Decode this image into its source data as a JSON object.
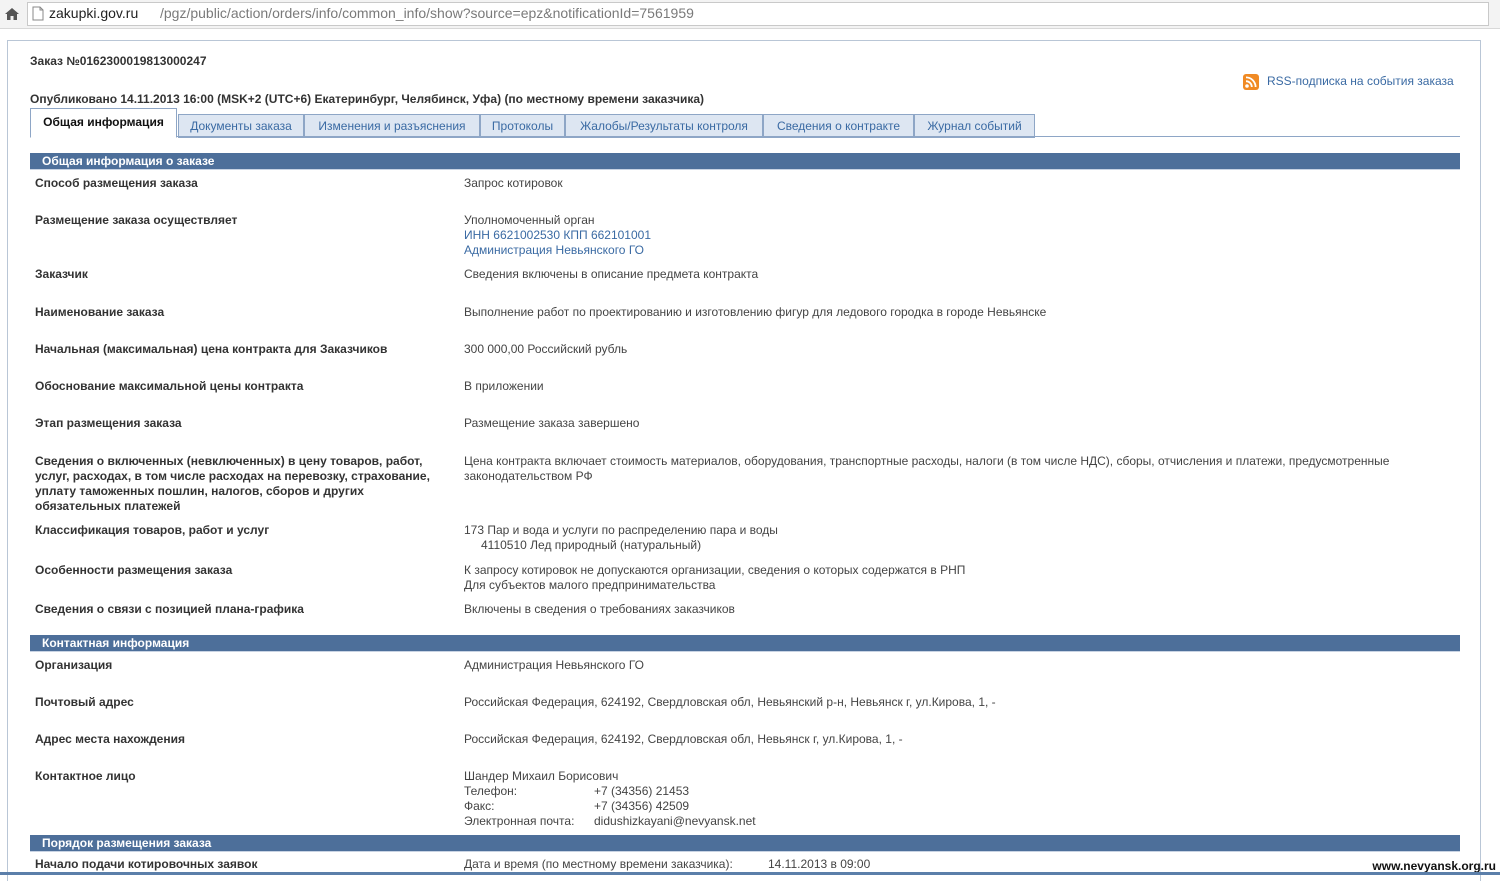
{
  "browser": {
    "url_host": "zakupki.gov.ru",
    "url_path": "/pgz/public/action/orders/info/common_info/show?source=epz&notificationId=7561959"
  },
  "page": {
    "order_number": "Заказ №0162300019813000247",
    "published": "Опубликовано 14.11.2013 16:00 (MSK+2 (UTC+6) Екатеринбург, Челябинск, Уфа) (по местному времени заказчика)",
    "rss_label": "RSS-подписка на события заказа"
  },
  "tabs": [
    "Общая информация",
    "Документы заказа",
    "Изменения и разъяснения",
    "Протоколы",
    "Жалобы/Результаты контроля",
    "Сведения о контракте",
    "Журнал событий"
  ],
  "general": {
    "title": "Общая информация о заказе",
    "method_label": "Способ размещения заказа",
    "method_value": "Запрос котировок",
    "placer_label": "Размещение заказа осуществляет",
    "placer_type": "Уполномоченный орган",
    "placer_inn": "ИНН 6621002530 КПП 662101001",
    "placer_org": "Администрация Невьянского ГО",
    "customer_label": "Заказчик",
    "customer_value": "Сведения включены в описание предмета контракта",
    "name_label": "Наименование заказа",
    "name_value": "Выполнение работ по проектированию и изготовлению фигур для ледового городка в городе Невьянске",
    "price_label": "Начальная (максимальная) цена контракта для Заказчиков",
    "price_value": "300 000,00 Российский рубль",
    "justification_label": "Обоснование максимальной цены контракта",
    "justification_value": "В приложении",
    "stage_label": "Этап размещения заказа",
    "stage_value": "Размещение заказа завершено",
    "included_label_1": "Сведения о включенных (невключенных) в цену товаров, работ,",
    "included_label_2": "услуг, расходах, в том числе расходах на перевозку, страхование,",
    "included_label_3": "уплату таможенных пошлин, налогов, сборов и других",
    "included_label_4": "обязательных платежей",
    "included_value_1": "Цена контракта включает стоимость материалов, оборудования, транспортные расходы, налоги (в том числе НДС), сборы, отчисления и платежи, предусмотренные",
    "included_value_2": "законодательством РФ",
    "classification_label": "Классификация товаров, работ и услуг",
    "classification_value_1": "173 Пар и вода и услуги по распределению пара и воды",
    "classification_value_2": "4110510 Лед природный (натуральный)",
    "features_label": "Особенности размещения заказа",
    "features_value_1": "К запросу котировок не допускаются организации, сведения о которых содержатся в РНП",
    "features_value_2": "Для субъектов малого предпринимательства",
    "plan_label": "Сведения о связи с позицией плана-графика",
    "plan_value": "Включены в сведения о требованиях заказчиков"
  },
  "contact": {
    "title": "Контактная информация",
    "org_label": "Организация",
    "org_value": "Администрация Невьянского ГО",
    "postal_label": "Почтовый адрес",
    "postal_value": "Российская Федерация, 624192, Свердловская обл, Невьянский р-н, Невьянск г, ул.Кирова, 1, -",
    "location_label": "Адрес места нахождения",
    "location_value": "Российская Федерация, 624192, Свердловская обл, Невьянск г, ул.Кирова, 1, -",
    "person_label": "Контактное лицо",
    "person_name": "Шандер Михаил Борисович",
    "phone_label": "Телефон:",
    "phone_value": "+7 (34356) 21453",
    "fax_label": "Факс:",
    "fax_value": "+7 (34356) 42509",
    "email_label": "Электронная почта:",
    "email_value": "didushizkayani@nevyansk.net"
  },
  "procedure": {
    "title": "Порядок размещения заказа",
    "start_label": "Начало подачи котировочных заявок",
    "start_note": "Дата и время (по местному времени заказчика):",
    "start_value": "14.11.2013 в 09:00"
  },
  "watermark": "www.nevyansk.org.ru"
}
